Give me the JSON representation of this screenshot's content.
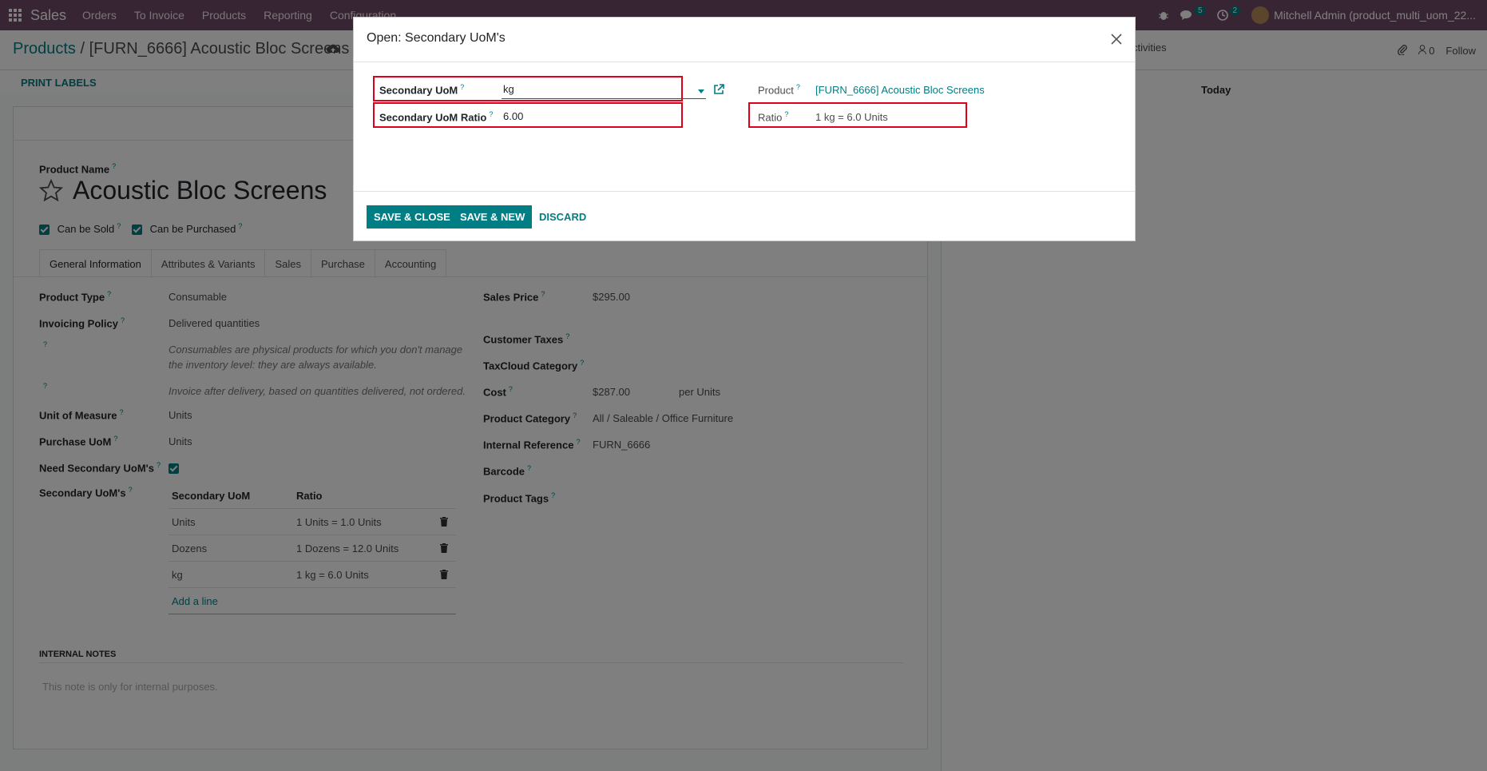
{
  "topbar": {
    "app_name": "Sales",
    "menu": [
      "Orders",
      "To Invoice",
      "Products",
      "Reporting",
      "Configuration"
    ],
    "messages_count": "5",
    "activities_count": "2",
    "user": "Mitchell Admin (product_multi_uom_22..."
  },
  "control_panel": {
    "breadcrumb_parent": "Products",
    "breadcrumb_sep": "/",
    "breadcrumb_current": "[FURN_6666] Acoustic Bloc Screens",
    "activities": "ctivities",
    "followers_count": "0",
    "follow_label": "Follow"
  },
  "buttonbar": {
    "print_labels": "PRINT LABELS"
  },
  "form": {
    "product_name_label": "Product Name",
    "product_name": "Acoustic Bloc Screens",
    "can_be_sold": "Can be Sold",
    "can_be_purchased": "Can be Purchased",
    "tabs": [
      "General Information",
      "Attributes & Variants",
      "Sales",
      "Purchase",
      "Accounting"
    ],
    "left": {
      "product_type_label": "Product Type",
      "product_type": "Consumable",
      "invoicing_policy_label": "Invoicing Policy",
      "invoicing_policy": "Delivered quantities",
      "help1_line1": "Consumables are physical products for which you don't manage",
      "help1_line2": "the inventory level: they are always available.",
      "help2": "Invoice after delivery, based on quantities delivered, not ordered.",
      "uom_label": "Unit of Measure",
      "uom": "Units",
      "purchase_uom_label": "Purchase UoM",
      "purchase_uom": "Units",
      "need_secondary_label": "Need Secondary UoM's",
      "secondary_uoms_label": "Secondary UoM's"
    },
    "secondary_table": {
      "headers": [
        "Secondary UoM",
        "Ratio"
      ],
      "rows": [
        {
          "uom": "Units",
          "ratio": "1 Units = 1.0 Units"
        },
        {
          "uom": "Dozens",
          "ratio": "1 Dozens = 12.0 Units"
        },
        {
          "uom": "kg",
          "ratio": "1 kg = 6.0 Units"
        }
      ],
      "add_line": "Add a line"
    },
    "right": {
      "sales_price_label": "Sales Price",
      "sales_price": "$295.00",
      "customer_taxes_label": "Customer Taxes",
      "taxcloud_label": "TaxCloud Category",
      "cost_label": "Cost",
      "cost": "$287.00",
      "cost_per": "per Units",
      "category_label": "Product Category",
      "category": "All / Saleable / Office Furniture",
      "internal_ref_label": "Internal Reference",
      "internal_ref": "FURN_6666",
      "barcode_label": "Barcode",
      "tags_label": "Product Tags"
    },
    "internal_notes_label": "INTERNAL NOTES",
    "internal_notes_placeholder": "This note is only for internal purposes."
  },
  "chatter": {
    "today": "Today"
  },
  "modal": {
    "title": "Open: Secondary UoM's",
    "secondary_uom_label": "Secondary UoM",
    "secondary_uom_value": "kg",
    "ratio_label": "Secondary UoM Ratio",
    "ratio_value": "6.00",
    "product_label": "Product",
    "product_value": "[FURN_6666] Acoustic Bloc Screens",
    "computed_ratio_label": "Ratio",
    "computed_ratio_value": "1 kg = 6.0 Units",
    "save_close": "SAVE & CLOSE",
    "save_new": "SAVE & NEW",
    "discard": "DISCARD"
  },
  "colors": {
    "brand": "#714b67",
    "accent": "#017e84",
    "highlight": "#e0001b"
  }
}
